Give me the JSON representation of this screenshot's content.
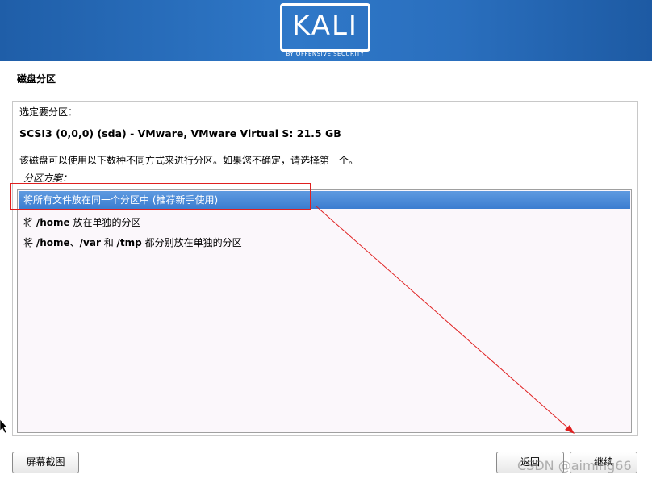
{
  "banner": {
    "logo_text": "KALI",
    "logo_subtitle": "BY OFFENSIVE SECURITY",
    "background_color": "#2f78c8"
  },
  "page": {
    "title": "磁盘分区",
    "prompt": "选定要分区：",
    "disk": "SCSI3 (0,0,0) (sda) - VMware, VMware Virtual S: 21.5 GB",
    "description": "该磁盘可以使用以下数种不同方式来进行分区。如果您不确定，请选择第一个。",
    "list_label": "分区方案："
  },
  "options": [
    {
      "parts": [
        "将所有文件放在同一个分区中 (推荐新手使用)"
      ],
      "selected": true
    },
    {
      "parts": [
        "将 ",
        "/home",
        " 放在单独的分区"
      ],
      "selected": false
    },
    {
      "parts": [
        "将 ",
        "/home",
        "、",
        "/var",
        " 和 ",
        "/tmp",
        " 都分别放在单独的分区"
      ],
      "selected": false
    }
  ],
  "buttons": {
    "screenshot": "屏幕截图",
    "back": "返回",
    "continue": "继续"
  },
  "watermark": "CSDN @aiming66",
  "colors": {
    "selection": "#3b7dd0",
    "annotation": "#e02020"
  }
}
